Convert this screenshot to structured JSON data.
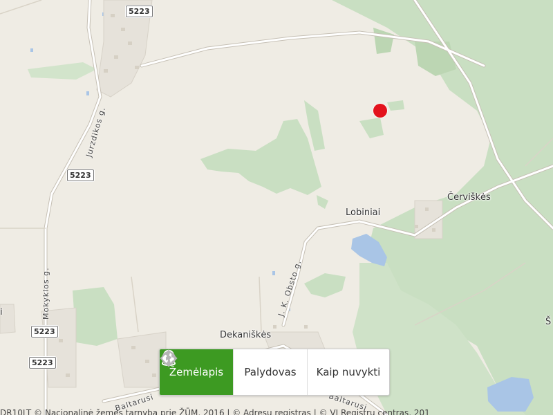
{
  "map": {
    "place_labels": {
      "lobiniai": "Lobiniai",
      "cerviskes": "Červiškės",
      "dekaniskes": "Dekaniškės",
      "edge_right": "Š",
      "edge_left": "i"
    },
    "street_labels": {
      "jurzdikos": "Jurzdikos g.",
      "mokyklos": "Mokyklos g.",
      "obsto": "J. K. Obsto g.",
      "baltarusiu_left": "Baltarusi",
      "baltarusiu_right": "Baltarusi"
    },
    "road_shields": [
      "5223",
      "5223",
      "5223",
      "5223"
    ],
    "marker_color": "#e3121c"
  },
  "view_tabs": [
    {
      "label": "Žemėlapis",
      "icon": "map-pin-icon",
      "active": true
    },
    {
      "label": "Palydovas",
      "icon": "globe-icon",
      "active": false
    },
    {
      "label": "Kaip nuvykti",
      "icon": "directions-icon",
      "active": false
    }
  ],
  "attribution": "DR10LT © Nacionalinė žemės tarnyba prie ŽŪM, 2016 | © Adresų registras | © VĮ Registrų centras, 201"
}
